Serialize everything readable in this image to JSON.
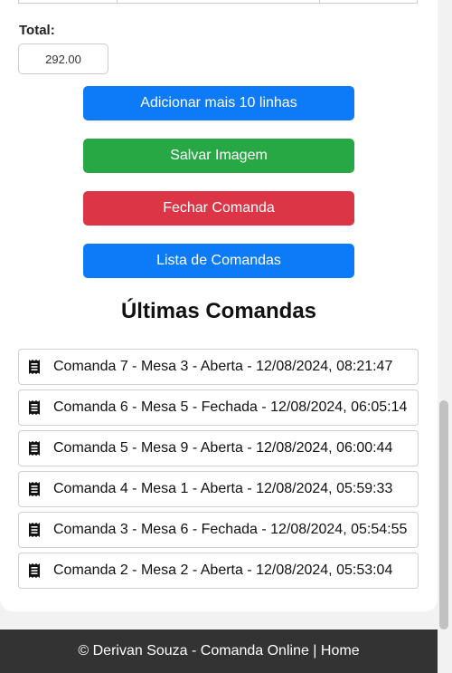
{
  "total": {
    "label": "Total:",
    "value": "292.00"
  },
  "buttons": {
    "add_lines": "Adicionar mais 10 linhas",
    "save_image": "Salvar Imagem",
    "close_order": "Fechar Comanda",
    "order_list": "Lista de Comandas"
  },
  "recent": {
    "title": "Últimas Comandas",
    "icon": "receipt-icon",
    "items": [
      "Comanda 7 - Mesa 3 - Aberta - 12/08/2024, 08:21:47",
      "Comanda 6 - Mesa 5 - Fechada - 12/08/2024, 06:05:14",
      "Comanda 5 - Mesa 9 - Aberta - 12/08/2024, 06:00:44",
      "Comanda 4 - Mesa 1 - Aberta - 12/08/2024, 05:59:33",
      "Comanda 3 - Mesa 6 - Fechada - 12/08/2024, 05:54:55",
      "Comanda 2 - Mesa 2 - Aberta - 12/08/2024, 05:53:04"
    ]
  },
  "footer": {
    "text": "© Derivan Souza - Comanda Online | ",
    "link": "Home"
  },
  "colors": {
    "primary": "#0d7bf8",
    "success": "#28a745",
    "danger": "#dc3545",
    "footer_bg": "#333333"
  }
}
